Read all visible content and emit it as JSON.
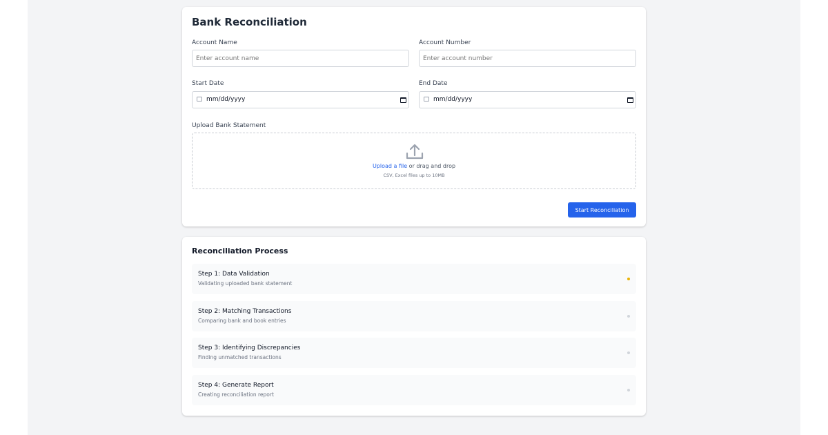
{
  "form": {
    "title": "Bank Reconciliation",
    "account_name": {
      "label": "Account Name",
      "placeholder": "Enter account name",
      "value": ""
    },
    "account_number": {
      "label": "Account Number",
      "placeholder": "Enter account number",
      "value": ""
    },
    "start_date": {
      "label": "Start Date",
      "display": "mm/dd/yyyy"
    },
    "end_date": {
      "label": "End Date",
      "display": "mm/dd/yyyy"
    },
    "upload": {
      "label": "Upload Bank Statement",
      "link_text": "Upload a file",
      "text": " or drag and drop",
      "hint": "CSV, Excel files up to 10MB",
      "icon": "upload-icon"
    },
    "submit_label": "Start Reconciliation"
  },
  "process": {
    "title": "Reconciliation Process",
    "steps": [
      {
        "title": "Step 1: Data Validation",
        "description": "Validating uploaded bank statement",
        "status_color": "#eab308"
      },
      {
        "title": "Step 2: Matching Transactions",
        "description": "Comparing bank and book entries",
        "status_color": "#d1d5db"
      },
      {
        "title": "Step 3: Identifying Discrepancies",
        "description": "Finding unmatched transactions",
        "status_color": "#d1d5db"
      },
      {
        "title": "Step 4: Generate Report",
        "description": "Creating reconciliation report",
        "status_color": "#d1d5db"
      }
    ]
  },
  "colors": {
    "accent": "#2563eb",
    "page_background": "#f3f4f6",
    "active_status": "#eab308",
    "pending_status": "#d1d5db"
  }
}
